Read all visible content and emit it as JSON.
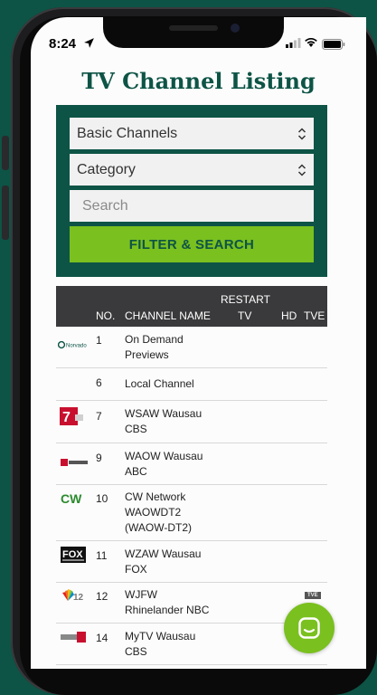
{
  "status_bar": {
    "time": "8:24"
  },
  "page": {
    "title": "TV Channel Listing"
  },
  "filters": {
    "channel_package": "Basic Channels",
    "category": "Category",
    "search_placeholder": "Search",
    "submit_label": "FILTER & SEARCH"
  },
  "table": {
    "headers": {
      "no": "NO.",
      "channel_name": "CHANNEL NAME",
      "restart_line1": "RESTART",
      "restart_line2": "TV",
      "hd": "HD",
      "tve": "TVE"
    },
    "rows": [
      {
        "logo": "norvado-logo",
        "logo_text": "Norvado",
        "no": "1",
        "name_lines": [
          "On Demand",
          "Previews"
        ],
        "tve": ""
      },
      {
        "logo": "",
        "logo_text": "",
        "no": "6",
        "name_lines": [
          "Local Channel"
        ],
        "tve": ""
      },
      {
        "logo": "wsaw-7-logo",
        "logo_text": "7",
        "no": "7",
        "name_lines": [
          "WSAW Wausau",
          "CBS"
        ],
        "tve": ""
      },
      {
        "logo": "waow-9-logo",
        "logo_text": "",
        "no": "9",
        "name_lines": [
          "WAOW Wausau",
          "ABC"
        ],
        "tve": ""
      },
      {
        "logo": "cw-logo",
        "logo_text": "CW",
        "no": "10",
        "name_lines": [
          "CW Network",
          "WAOWDT2",
          "(WAOW-DT2)"
        ],
        "tve": ""
      },
      {
        "logo": "fox-logo",
        "logo_text": "FOX",
        "no": "11",
        "name_lines": [
          "WZAW Wausau",
          "FOX"
        ],
        "tve": ""
      },
      {
        "logo": "nbc-12-logo",
        "logo_text": "12",
        "no": "12",
        "name_lines": [
          "WJFW",
          "Rhinelander NBC"
        ],
        "tve": "TVE"
      },
      {
        "logo": "mytv-logo",
        "logo_text": "",
        "no": "14",
        "name_lines": [
          "MyTV Wausau",
          "CBS"
        ],
        "tve": ""
      }
    ]
  },
  "colors": {
    "brand": "#0d5446",
    "accent": "#7ac01f",
    "header": "#3a3a3c"
  }
}
